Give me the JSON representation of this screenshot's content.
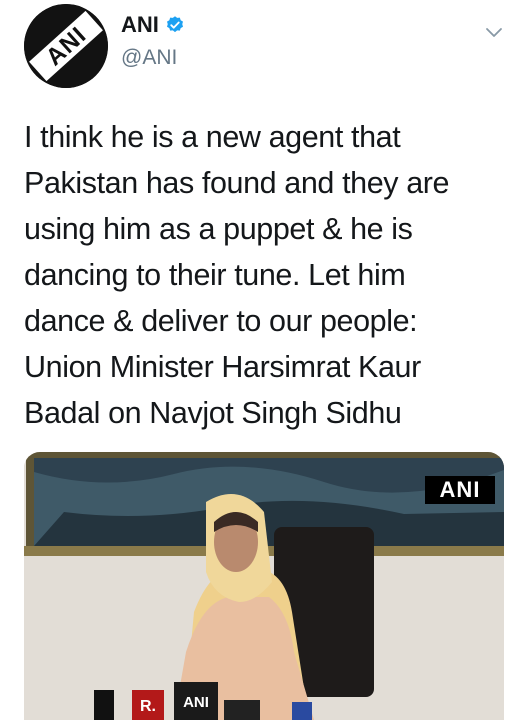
{
  "account": {
    "name": "ANI",
    "handle": "@ANI",
    "avatar_text": "ANI",
    "verified": true
  },
  "tweet": {
    "lines": [
      "I think he is a new agent that",
      "Pakistan has found and they are",
      "using him as a puppet & he is",
      "dancing to their tune. Let him",
      "dance & deliver to our people:",
      "Union Minister Harsimrat Kaur",
      "Badal on Navjot Singh Sidhu"
    ]
  },
  "media": {
    "watermark": "ANI",
    "mic_labels": [
      "R.",
      "ANI"
    ]
  },
  "icons": {
    "verified": "verified-badge-icon",
    "menu": "chevron-down-icon"
  },
  "colors": {
    "text": "#14171a",
    "secondary": "#657786",
    "verified": "#1da1f2"
  }
}
